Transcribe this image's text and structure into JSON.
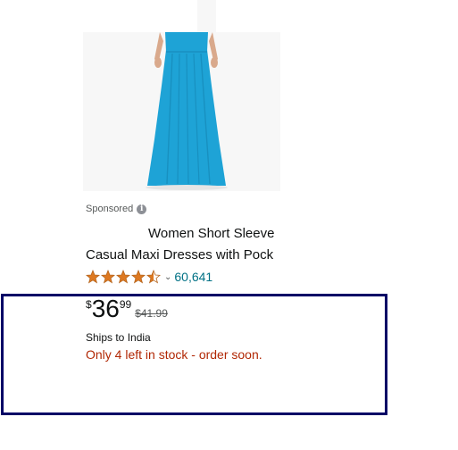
{
  "product": {
    "sponsored_label": "Sponsored",
    "title_line1": "Women Short Sleeve",
    "title_line2": "Casual Maxi Dresses with Pock",
    "image_icon": "maxi-dress-product-image",
    "rating": 4.5,
    "rating_max": 5,
    "review_count": "60,641",
    "price": {
      "symbol": "$",
      "whole": "36",
      "fraction": "99",
      "list_price": "$41.99"
    },
    "shipping": "Ships to India",
    "stock_message": "Only 4 left in stock - order soon."
  },
  "colors": {
    "star": "#de7921",
    "link": "#007185",
    "stock": "#b12704",
    "highlight_border": "#000066",
    "dress": "#1ea3d6"
  },
  "icons": {
    "info": "info-icon",
    "star": "star-icon",
    "chevron": "chevron-down-icon"
  }
}
